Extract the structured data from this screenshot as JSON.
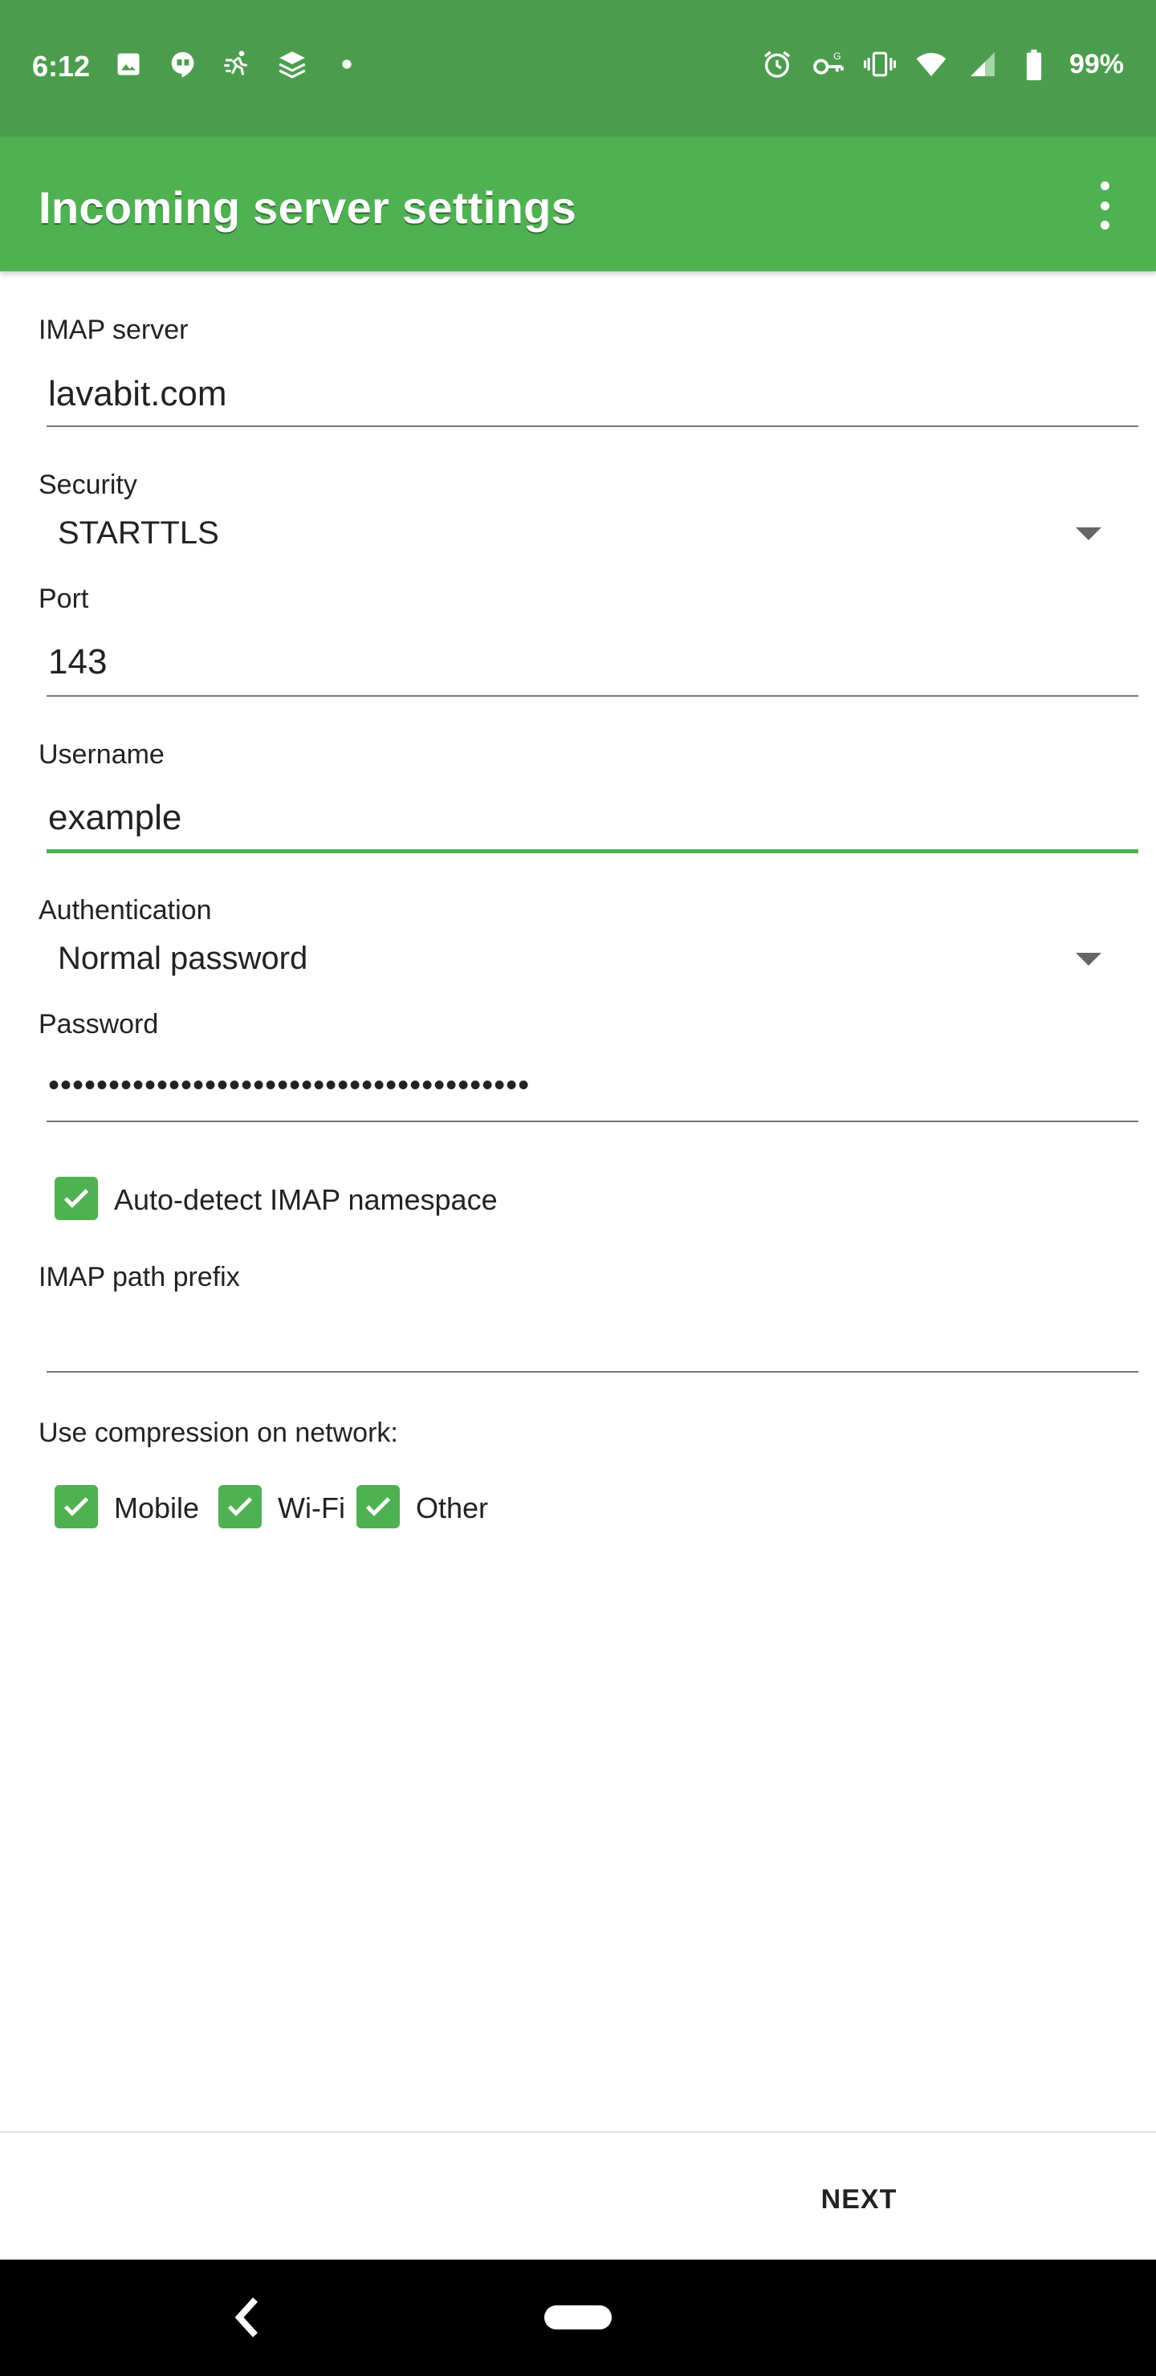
{
  "status_bar": {
    "time": "6:12",
    "battery": "99%",
    "left_icons": [
      "image-icon",
      "hangouts-icon",
      "fit-icon",
      "layers-icon",
      "dot-icon"
    ],
    "right_icons": [
      "alarm-icon",
      "vpn-key-icon",
      "vibrate-icon",
      "wifi-icon",
      "signal-icon",
      "battery-icon"
    ]
  },
  "app_bar": {
    "title": "Incoming server settings",
    "color": "#4fb152"
  },
  "form": {
    "imap_server": {
      "label": "IMAP server",
      "value": "lavabit.com"
    },
    "security": {
      "label": "Security",
      "value": "STARTTLS"
    },
    "port": {
      "label": "Port",
      "value": "143"
    },
    "username": {
      "label": "Username",
      "value": "example"
    },
    "authentication": {
      "label": "Authentication",
      "value": "Normal password"
    },
    "password": {
      "label": "Password",
      "value": "••••••••••••••••••••••••••••••••••••••••"
    },
    "auto_detect": {
      "label": "Auto-detect IMAP namespace",
      "checked": true
    },
    "path_prefix": {
      "label": "IMAP path prefix",
      "value": ""
    },
    "compression": {
      "label": "Use compression on network:",
      "options": [
        {
          "label": "Mobile",
          "checked": true
        },
        {
          "label": "Wi-Fi",
          "checked": true
        },
        {
          "label": "Other",
          "checked": true
        }
      ]
    }
  },
  "footer": {
    "next_label": "NEXT"
  }
}
